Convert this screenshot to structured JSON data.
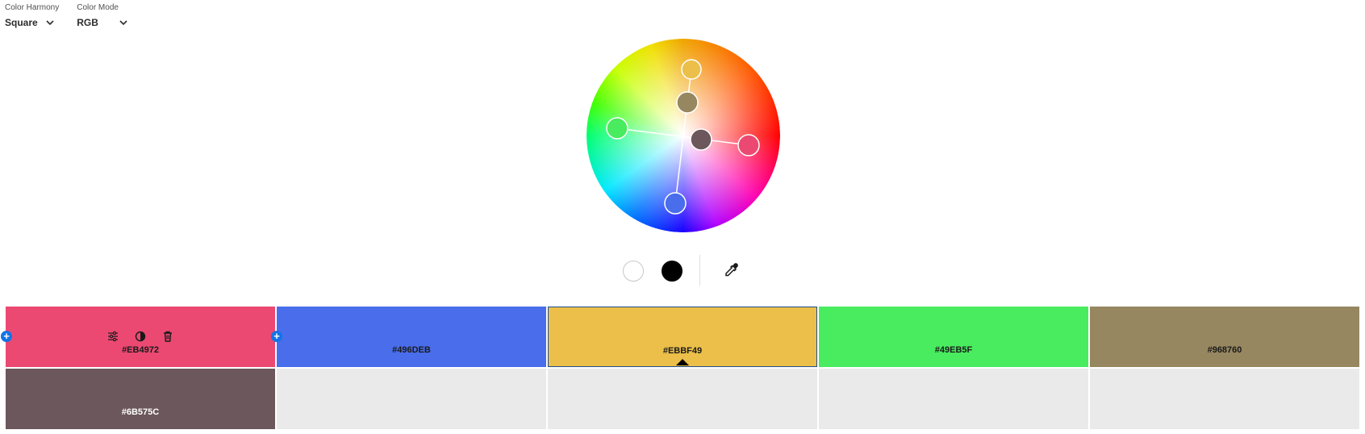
{
  "controls": {
    "harmony": {
      "label": "Color Harmony",
      "value": "Square"
    },
    "mode": {
      "label": "Color Mode",
      "value": "RGB"
    }
  },
  "icons": {
    "dropdown": "chevron-down-icon",
    "adjust": "sliders-icon",
    "contrast": "contrast-icon",
    "delete": "trash-icon",
    "add": "plus-icon",
    "picker": "eyedropper-icon"
  },
  "palette": [
    {
      "hex": "#EB4972",
      "color": "#eb4972"
    },
    {
      "hex": "#496DEB",
      "color": "#496deb"
    },
    {
      "hex": "#EBBF49",
      "color": "#ebbf49"
    },
    {
      "hex": "#49EB5F",
      "color": "#49eb5f"
    },
    {
      "hex": "#968760",
      "color": "#968760"
    },
    {
      "hex": "#6B575C",
      "color": "#6b575c"
    }
  ],
  "active_index": 2,
  "accent": "#1473e6"
}
